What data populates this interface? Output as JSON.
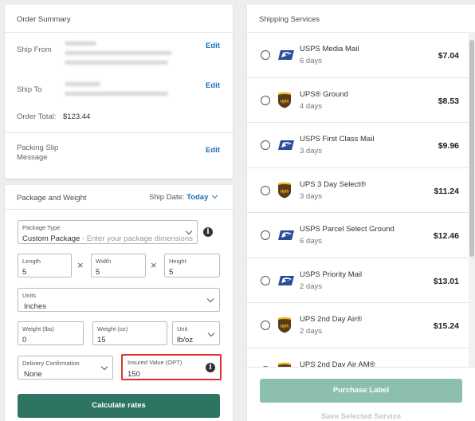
{
  "order_summary": {
    "title": "Order Summary",
    "ship_from_label": "Ship From",
    "ship_to_label": "Ship To",
    "order_total_label": "Order Total:",
    "order_total_value": "$123.44",
    "packing_slip_label_1": "Packing Slip",
    "packing_slip_label_2": "Message",
    "edit_label": "Edit"
  },
  "package": {
    "title": "Package and Weight",
    "ship_date_label": "Ship Date:",
    "ship_date_value": "Today",
    "package_type_label": "Package Type",
    "package_type_value": "Custom Package",
    "package_type_hint": " - Enter your package dimensions",
    "length_label": "Length",
    "length_value": "5",
    "width_label": "Width",
    "width_value": "5",
    "height_label": "Height",
    "height_value": "5",
    "units_label": "Units",
    "units_value": "Inches",
    "weight_lbs_label": "Weight (lbs)",
    "weight_lbs_value": "0",
    "weight_oz_label": "Weight (oz)",
    "weight_oz_value": "15",
    "unit_label": "Unit",
    "unit_value": "lb/oz",
    "delivery_label": "Delivery Confirmation",
    "delivery_value": "None",
    "insured_label": "Insured Value (OPT)",
    "insured_value": "150",
    "calculate_label": "Calculate rates",
    "times_glyph": "×",
    "info_glyph": "i"
  },
  "shipping": {
    "title": "Shipping Services",
    "services": [
      {
        "name": "USPS Media Mail",
        "days": "6 days",
        "price": "$7.04",
        "carrier": "usps"
      },
      {
        "name": "UPS® Ground",
        "days": "4 days",
        "price": "$8.53",
        "carrier": "ups"
      },
      {
        "name": "USPS First Class Mail",
        "days": "3 days",
        "price": "$9.96",
        "carrier": "usps"
      },
      {
        "name": "UPS 3 Day Select®",
        "days": "3 days",
        "price": "$11.24",
        "carrier": "ups"
      },
      {
        "name": "USPS Parcel Select Ground",
        "days": "6 days",
        "price": "$12.46",
        "carrier": "usps"
      },
      {
        "name": "USPS Priority Mail",
        "days": "2 days",
        "price": "$13.01",
        "carrier": "usps"
      },
      {
        "name": "UPS 2nd Day Air®",
        "days": "2 days",
        "price": "$15.24",
        "carrier": "ups"
      },
      {
        "name": "UPS 2nd Day Air AM®",
        "days": "",
        "price": "",
        "carrier": "ups"
      }
    ],
    "purchase_label": "Purchase Label",
    "save_label": "Save Selected Service"
  },
  "colors": {
    "accent": "#1b6fb8",
    "primary_button": "#2e7462",
    "disabled_button": "#8cbfad",
    "highlight_border": "#e0312f"
  }
}
